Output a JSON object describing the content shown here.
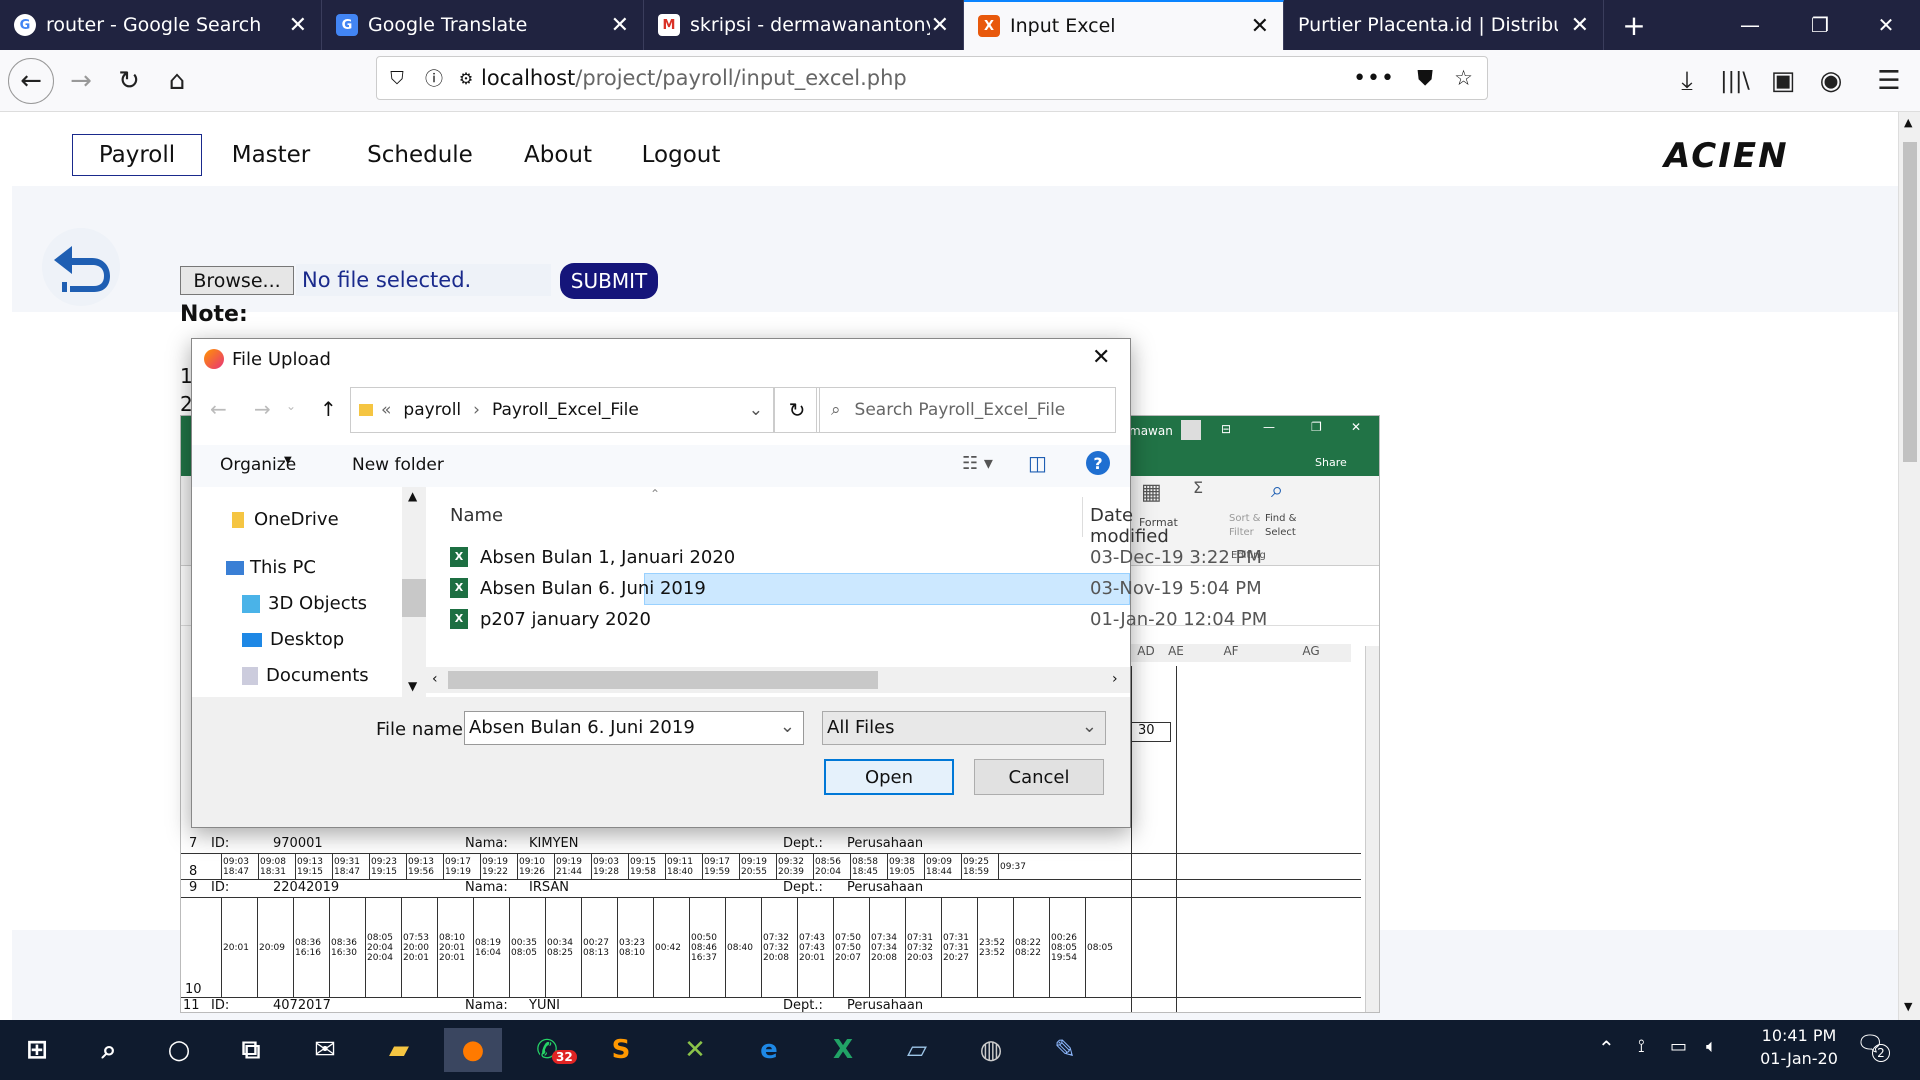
{
  "tabs": [
    {
      "title": "router - Google Search",
      "icon": "G"
    },
    {
      "title": "Google Translate",
      "icon": "G"
    },
    {
      "title": "skripsi - dermawanantony@g",
      "icon": "M"
    },
    {
      "title": "Input Excel",
      "icon": "X"
    },
    {
      "title": "Purtier Placenta.id | Distributor Re",
      "icon": ""
    }
  ],
  "address": {
    "host": "localhost",
    "path": "/project/payroll/input_excel.php"
  },
  "page": {
    "menu": [
      "Payroll",
      "Master",
      "Schedule",
      "About",
      "Logout"
    ],
    "logo": "ACIEN",
    "browse_label": "Browse...",
    "file_status": "No file selected.",
    "submit_label": "SUBMIT",
    "note_label": "Note:",
    "note_lines": [
      "1",
      "2"
    ]
  },
  "excel": {
    "ribbon_user": "mawan",
    "share": "Share",
    "format": "Format",
    "sort": "Sort &\nFilter",
    "find": "Find &\nSelect",
    "editing": "Editing",
    "cols": [
      "AD",
      "AE",
      "AF",
      "AG"
    ],
    "cell_30": "30",
    "row_nums": [
      "7",
      "8",
      "9",
      "10",
      "11"
    ],
    "rows": [
      {
        "id": "970001",
        "nama": "KIMYEN",
        "dept": "Perusahaan"
      },
      {
        "id": "22042019",
        "nama": "IRSAN",
        "dept": "Perusahaan"
      },
      {
        "id": "4072017",
        "nama": "YUNI",
        "dept": "Perusahaan"
      }
    ],
    "labels": {
      "id": "ID:",
      "nama": "Nama:",
      "dept": "Dept.:"
    },
    "times_row8": [
      "09:03\n18:47",
      "09:08\n18:31",
      "09:13\n19:15",
      "09:31\n18:47",
      "09:23\n19:15",
      "09:13\n19:56",
      "09:17\n19:19",
      "09:19\n19:22",
      "09:10\n19:26",
      "09:19\n21:44",
      "09:03\n19:28",
      "09:15\n19:58",
      "09:11\n18:40",
      "09:17\n19:59",
      "09:19\n20:55",
      "09:32\n20:39",
      "08:56\n20:04",
      "08:58\n18:45",
      "09:38\n19:05",
      "09:09\n18:44",
      "09:25\n18:59",
      "09:37"
    ],
    "times_row10": [
      "20:01",
      "20:09",
      "08:36\n16:16",
      "08:36\n16:30",
      "08:05\n20:04\n20:04",
      "07:53\n20:00\n20:01",
      "08:10\n20:01\n20:01",
      "08:19\n16:04",
      "00:35\n08:05",
      "00:34\n08:25",
      "00:27\n08:13",
      "03:23\n08:10",
      "00:42",
      "00:50\n08:46\n16:37",
      "08:40",
      "07:32\n07:32\n20:08",
      "07:43\n07:43\n20:01",
      "07:50\n07:50\n20:07",
      "07:34\n07:34\n20:08",
      "07:31\n07:32\n20:03",
      "07:31\n07:31\n20:27",
      "23:52\n23:52",
      "08:22\n08:22",
      "00:26\n08:05\n19:54",
      "08:05"
    ]
  },
  "dialog": {
    "title": "File Upload",
    "breadcrumb": [
      "payroll",
      "Payroll_Excel_File"
    ],
    "search_placeholder": "Search Payroll_Excel_File",
    "organize": "Organize",
    "new_folder": "New folder",
    "nav_items": [
      "OneDrive",
      "This PC",
      "3D Objects",
      "Desktop",
      "Documents"
    ],
    "col_name": "Name",
    "col_date": "Date modified",
    "files": [
      {
        "name": "Absen Bulan 1, Januari 2020",
        "date": "03-Dec-19 3:22 PM",
        "selected": false
      },
      {
        "name": "Absen Bulan 6. Juni 2019",
        "date": "03-Nov-19 5:04 PM",
        "selected": true
      },
      {
        "name": "p207 january 2020",
        "date": "01-Jan-20 12:04 PM",
        "selected": false
      }
    ],
    "filename_label": "File name:",
    "filename_value": "Absen Bulan 6. Juni 2019",
    "filter": "All Files",
    "open": "Open",
    "cancel": "Cancel"
  },
  "taskbar": {
    "time": "10:41 PM",
    "date": "01-Jan-20",
    "whatsapp_badge": "32",
    "notif_count": "2"
  },
  "colors": {
    "tabbar": "#202340",
    "excel": "#217346",
    "submit": "#15157a",
    "taskbar": "#0f1b2e",
    "selection": "#cce8ff"
  }
}
